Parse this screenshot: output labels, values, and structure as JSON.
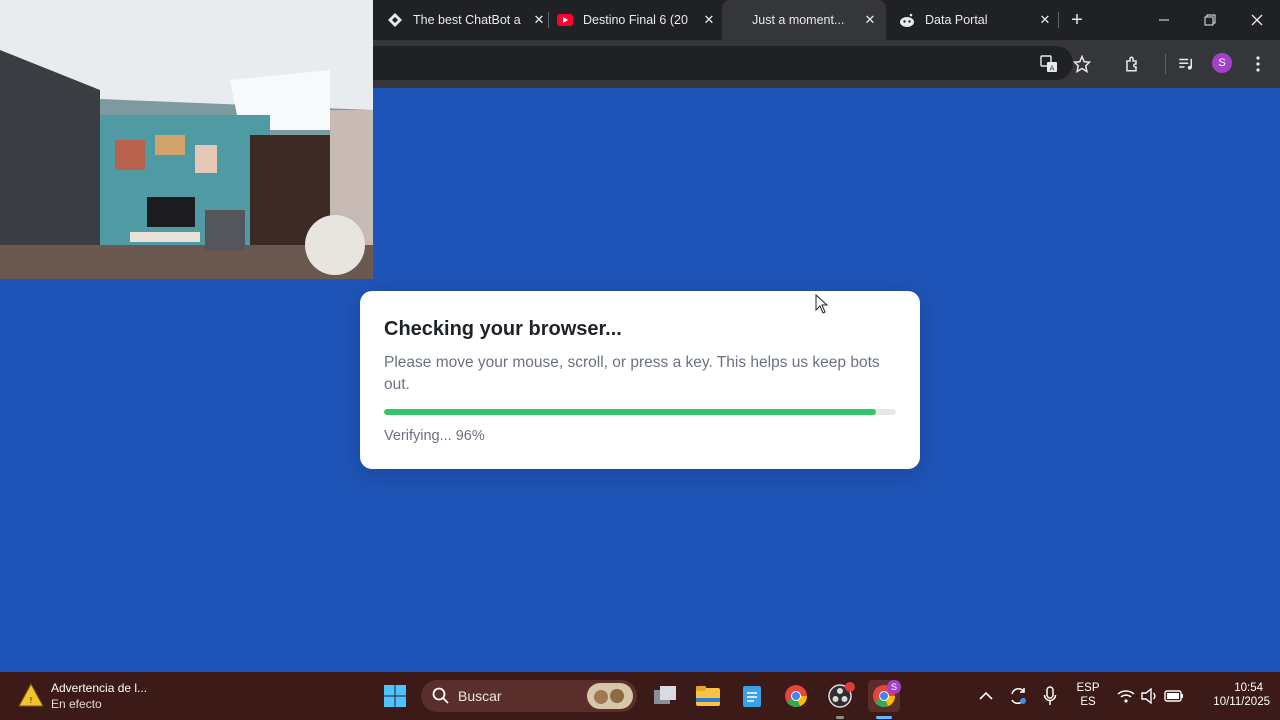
{
  "browser": {
    "tabs": [
      {
        "title": "The best ChatBot a",
        "icon": "bot-icon",
        "active": false
      },
      {
        "title": "Destino Final 6 (20",
        "icon": "youtube-icon",
        "active": false
      },
      {
        "title": "Just a moment...",
        "icon": "",
        "active": true
      },
      {
        "title": "Data Portal",
        "icon": "reddit-icon",
        "active": false
      }
    ],
    "profile_initial": "S"
  },
  "page": {
    "background_color": "#1f55b8",
    "heading": "Checking your browser...",
    "description": "Please move your mouse, scroll, or press a key. This helps us keep bots out.",
    "progress_percent": 96,
    "progress_color": "#34c46a",
    "status_text": "Verifying... 96%"
  },
  "taskbar": {
    "notification_title": "Advertencia de l...",
    "notification_subtitle": "En efecto",
    "search_placeholder": "Buscar",
    "language_top": "ESP",
    "language_bottom": "ES",
    "time": "10:54",
    "date": "10/11/2025",
    "chrome_badge": "S"
  }
}
